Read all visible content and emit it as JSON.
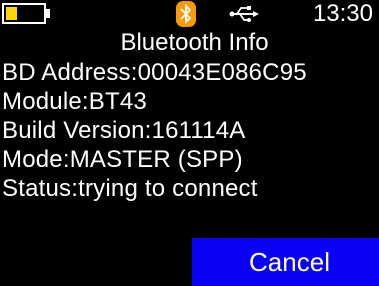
{
  "status_bar": {
    "battery_level": 0.3,
    "time": "13:30",
    "icons": [
      "battery-icon",
      "bluetooth-icon",
      "usb-icon"
    ]
  },
  "colors": {
    "background": "#000000",
    "text": "#ffffff",
    "battery_fill": "#ffd400",
    "bluetooth_icon": "#ff9a00",
    "cancel_button": "#0a00f5"
  },
  "screen": {
    "title": "Bluetooth Info",
    "lines": [
      "BD Address:00043E086C95",
      "Module:BT43",
      "Build Version:161114A",
      "Mode:MASTER (SPP)",
      "Status:trying to connect"
    ]
  },
  "actions": {
    "cancel_label": "Cancel"
  }
}
